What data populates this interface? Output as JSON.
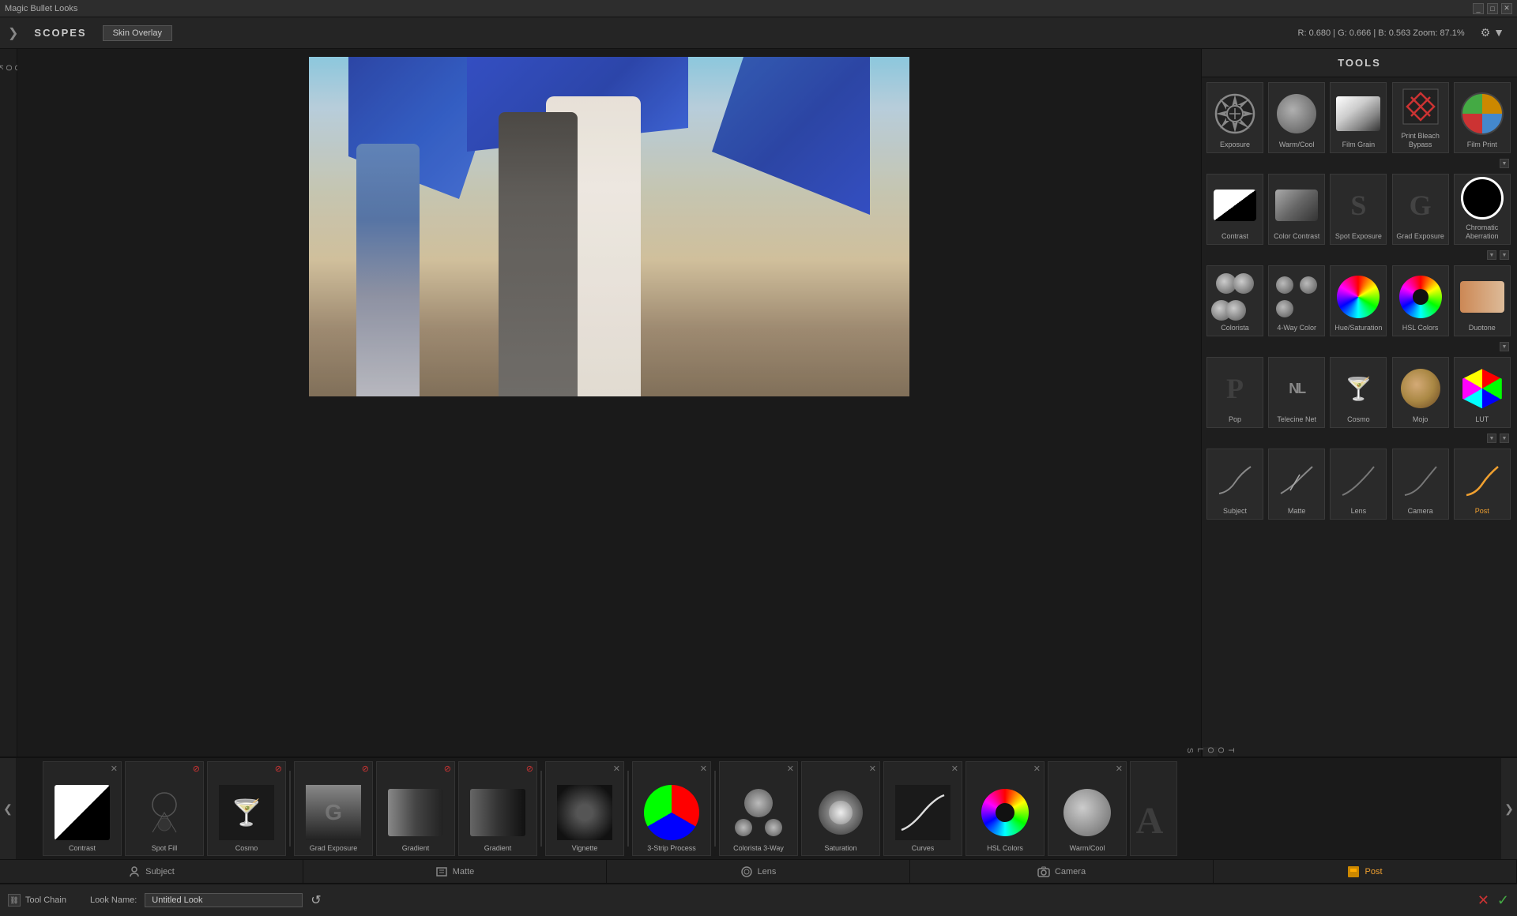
{
  "titlebar": {
    "title": "Magic Bullet Looks",
    "controls": [
      "minimize",
      "maximize",
      "close"
    ]
  },
  "topbar": {
    "nav_arrow": "❯",
    "scopes_label": "SCOPES",
    "skin_overlay_btn": "Skin Overlay",
    "color_info": "R: 0.680  |  G: 0.666  |  B: 0.563    Zoom: 87.1%",
    "gear_icon": "⚙",
    "dropdown_arrow": "▼"
  },
  "tools_panel": {
    "header": "TOOLS",
    "tools": [
      {
        "id": "exposure",
        "label": "Exposure",
        "row": 1
      },
      {
        "id": "warm_cool",
        "label": "Warm/Cool",
        "row": 1
      },
      {
        "id": "film_grain",
        "label": "Film Grain",
        "row": 1
      },
      {
        "id": "print_bleach",
        "label": "Print Bleach Bypass",
        "row": 1
      },
      {
        "id": "film_print",
        "label": "Film Print",
        "row": 1
      },
      {
        "id": "contrast",
        "label": "Contrast",
        "row": 2
      },
      {
        "id": "color_contrast",
        "label": "Color Contrast",
        "row": 2
      },
      {
        "id": "spot_exposure",
        "label": "Spot Exposure",
        "row": 2
      },
      {
        "id": "grad_exposure",
        "label": "Grad Exposure",
        "row": 2
      },
      {
        "id": "chromatic_aberration",
        "label": "Chromatic Aberration",
        "row": 2
      },
      {
        "id": "colorista",
        "label": "Colorista",
        "row": 3
      },
      {
        "id": "four_way_color",
        "label": "4-Way Color",
        "row": 3
      },
      {
        "id": "hue_saturation",
        "label": "Hue/Saturation",
        "row": 3
      },
      {
        "id": "hsl_colors",
        "label": "HSL Colors",
        "row": 3
      },
      {
        "id": "duotone",
        "label": "Duotone",
        "row": 3
      },
      {
        "id": "pop",
        "label": "Pop",
        "row": 4
      },
      {
        "id": "telecine_net",
        "label": "Telecine Net",
        "row": 4
      },
      {
        "id": "cosmo",
        "label": "Cosmo",
        "row": 4
      },
      {
        "id": "mojo",
        "label": "Mojo",
        "row": 4
      },
      {
        "id": "lut",
        "label": "LUT",
        "row": 4
      },
      {
        "id": "subject",
        "label": "Subject",
        "row": 5,
        "section": "subject"
      },
      {
        "id": "matte",
        "label": "Matte",
        "row": 5,
        "section": "matte"
      },
      {
        "id": "lens",
        "label": "Lens",
        "row": 5,
        "section": "lens"
      },
      {
        "id": "camera",
        "label": "Camera",
        "row": 5,
        "section": "camera"
      },
      {
        "id": "post",
        "label": "Post",
        "row": 5,
        "section": "post",
        "active": true
      }
    ]
  },
  "strip": {
    "left_arrow": "❮",
    "right_arrow": "❯",
    "items": [
      {
        "id": "contrast",
        "label": "Contrast"
      },
      {
        "id": "spot_fill",
        "label": "Spot Fill"
      },
      {
        "id": "cosmo_strip",
        "label": "Cosmo"
      },
      {
        "id": "grad_exposure",
        "label": "Grad Exposure"
      },
      {
        "id": "gradient1",
        "label": "Gradient"
      },
      {
        "id": "gradient2",
        "label": "Gradient"
      },
      {
        "id": "vignette",
        "label": "Vignette"
      },
      {
        "id": "three_strip",
        "label": "3-Strip Process"
      },
      {
        "id": "colorista_3way",
        "label": "Colorista 3-Way"
      },
      {
        "id": "saturation",
        "label": "Saturation"
      },
      {
        "id": "curves",
        "label": "Curves"
      },
      {
        "id": "hsl_colors_strip",
        "label": "HSL Colors"
      },
      {
        "id": "warm_cool_strip",
        "label": "Warm/Cool"
      }
    ]
  },
  "bottom_tabs": [
    {
      "id": "subject",
      "label": "Subject",
      "icon": "person"
    },
    {
      "id": "matte",
      "label": "Matte",
      "icon": "film"
    },
    {
      "id": "lens",
      "label": "Lens",
      "icon": "lens"
    },
    {
      "id": "camera",
      "label": "Camera",
      "icon": "camera"
    },
    {
      "id": "post",
      "label": "Post",
      "icon": "star",
      "active": true,
      "color": "post"
    }
  ],
  "footer": {
    "tool_chain_label": "Tool Chain",
    "look_name_label": "Look Name:",
    "look_name_value": "Untitled Look",
    "reset_icon": "↺",
    "cancel_icon": "✕",
    "confirm_icon": "✓",
    "looks_label": "L\nO\nO\nK\nS",
    "tools_label": "T\nO\nO\nL\nS"
  }
}
